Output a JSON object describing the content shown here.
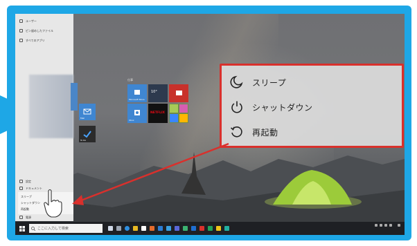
{
  "start_menu": {
    "top_items": [
      "ユーザー",
      "ピン留めしたファイル",
      "すべてのアプリ"
    ],
    "group_label": "仕事",
    "power_label": "電源",
    "power_menu": [
      "スリープ",
      "シャットダウン",
      "再起動"
    ],
    "bottom_items": [
      "設定",
      "電源",
      "ドキュメント"
    ]
  },
  "tiles": {
    "mail": "Mail",
    "todo": "To Do",
    "store": "Microsoft Store",
    "weather": "10°",
    "photos": "Xbox",
    "netflix": "NETFLIX"
  },
  "callout": {
    "items": [
      {
        "label": "スリープ",
        "icon": "moon-icon"
      },
      {
        "label": "シャットダウン",
        "icon": "power-icon"
      },
      {
        "label": "再起動",
        "icon": "restart-icon"
      }
    ],
    "border_color": "#d9302c"
  },
  "taskbar": {
    "search_placeholder": "ここに入力して検索"
  },
  "colors": {
    "frame": "#1ea7e6",
    "accent": "#d9302c"
  }
}
